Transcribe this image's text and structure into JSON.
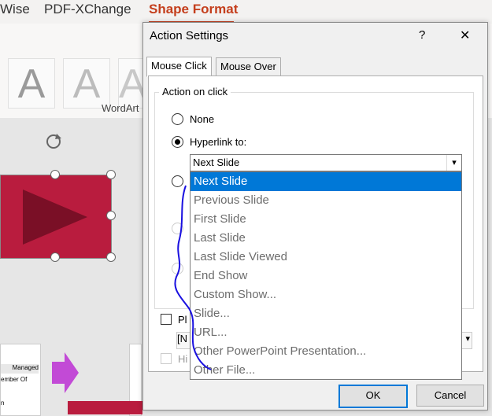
{
  "ribbon": {
    "tabs": [
      "Wise",
      "PDF-XChange",
      "Shape Format"
    ],
    "group_label": "WordArt",
    "wordart_letter": "A"
  },
  "slide": {
    "thumb_text_1": "Managed",
    "thumb_text_2": "ember Of",
    "thumb_text_3": "n"
  },
  "dialog": {
    "title": "Action Settings",
    "help": "?",
    "close": "✕",
    "tabs": [
      "Mouse Click",
      "Mouse Over"
    ],
    "group_label": "Action on click",
    "option_none": "None",
    "option_hyperlink": "Hyperlink to:",
    "combo_value": "Next Slide",
    "play_sound_label": "Pl",
    "play_sound_value": "[N",
    "highlight_label": "Hi",
    "ok": "OK",
    "cancel": "Cancel"
  },
  "dropdown": {
    "items": [
      "Next Slide",
      "Previous Slide",
      "First Slide",
      "Last Slide",
      "Last Slide Viewed",
      "End Show",
      "Custom Show...",
      "Slide...",
      "URL...",
      "Other PowerPoint Presentation...",
      "Other File..."
    ]
  },
  "colors": {
    "accent": "#0078d7",
    "shape_fill": "#b91c3e",
    "annotation": "#1a10e0",
    "tab_active": "#c43e1c"
  }
}
